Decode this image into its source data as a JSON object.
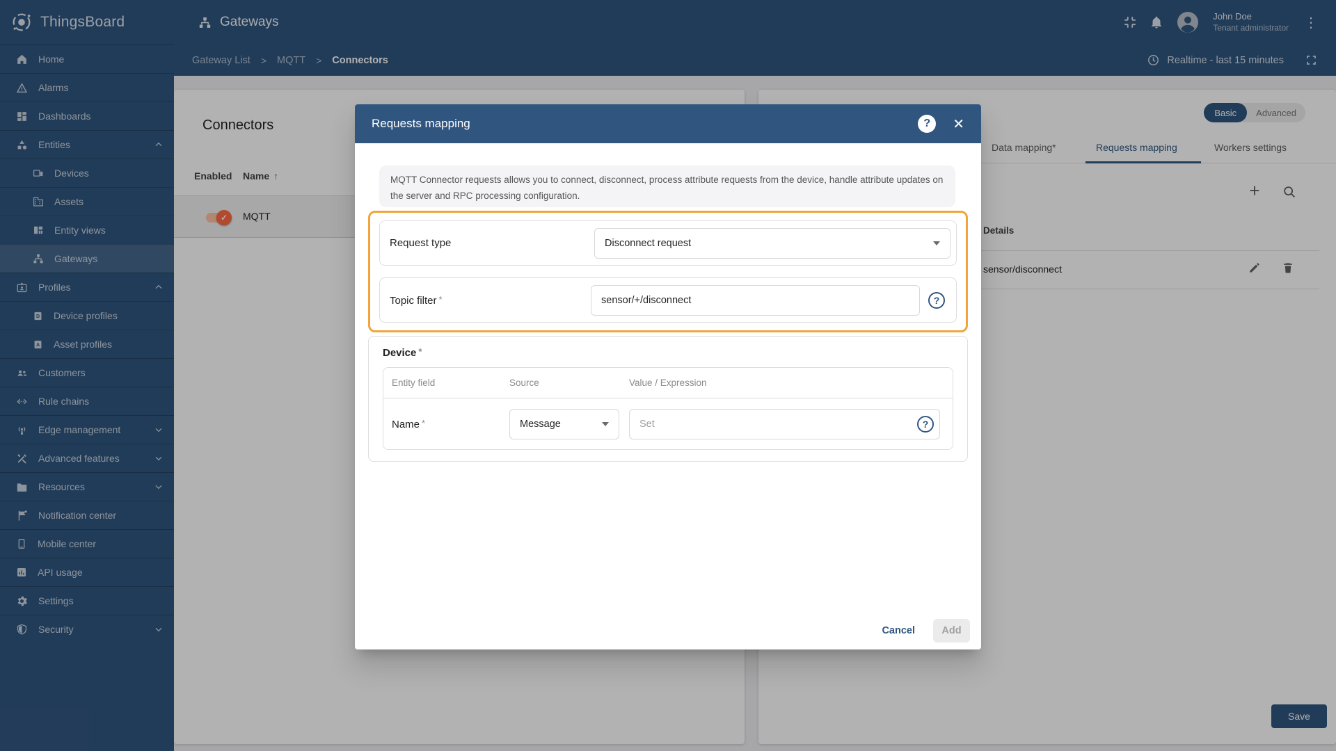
{
  "app": {
    "name": "ThingsBoard"
  },
  "topbar": {
    "page_title": "Gateways",
    "user": {
      "name": "John Doe",
      "role": "Tenant administrator"
    }
  },
  "breadcrumb": {
    "items": [
      "Gateway List",
      "MQTT",
      "Connectors"
    ],
    "separator": ">"
  },
  "timewindow": {
    "label": "Realtime - last 15 minutes"
  },
  "sidebar": {
    "items": [
      "Home",
      "Alarms",
      "Dashboards",
      "Entities",
      "Devices",
      "Assets",
      "Entity views",
      "Gateways",
      "Profiles",
      "Device profiles",
      "Asset profiles",
      "Customers",
      "Rule chains",
      "Edge management",
      "Advanced features",
      "Resources",
      "Notification center",
      "Mobile center",
      "API usage",
      "Settings",
      "Security"
    ]
  },
  "connectors_panel": {
    "title": "Connectors",
    "col_enabled": "Enabled",
    "col_name": "Name",
    "row_name": "MQTT"
  },
  "config_panel": {
    "mode_basic": "Basic",
    "mode_advanced": "Advanced",
    "tab_data_mapping": "Data mapping*",
    "tab_requests_mapping": "Requests mapping",
    "tab_workers_settings": "Workers settings",
    "details_header": "Details",
    "row_value": "sensor/disconnect",
    "save_label": "Save"
  },
  "modal": {
    "title": "Requests mapping",
    "description": "MQTT Connector requests allows you to connect, disconnect, process attribute requests from the device, handle attribute updates on the server and RPC processing configuration.",
    "request_type": {
      "label": "Request type",
      "value": "Disconnect request"
    },
    "topic_filter": {
      "label": "Topic filter",
      "value": "sensor/+/disconnect"
    },
    "device": {
      "heading": "Device",
      "col_entity_field": "Entity field",
      "col_source": "Source",
      "col_value": "Value / Expression",
      "row_field": "Name",
      "row_source": "Message",
      "row_value_placeholder": "Set"
    },
    "cancel_label": "Cancel",
    "add_label": "Add"
  },
  "icons": {
    "help": "?",
    "close": "✕",
    "more_vert": "⋮",
    "sort_asc": "↑",
    "plus": "+",
    "check": "✓",
    "required": "*"
  },
  "colors": {
    "primary": "#305680",
    "highlight_border": "#F1A53C",
    "toggle_on": "#FF6A42",
    "toggle_track": "#FFC2A4",
    "backdrop": "rgba(0,0,0,0.30)"
  }
}
